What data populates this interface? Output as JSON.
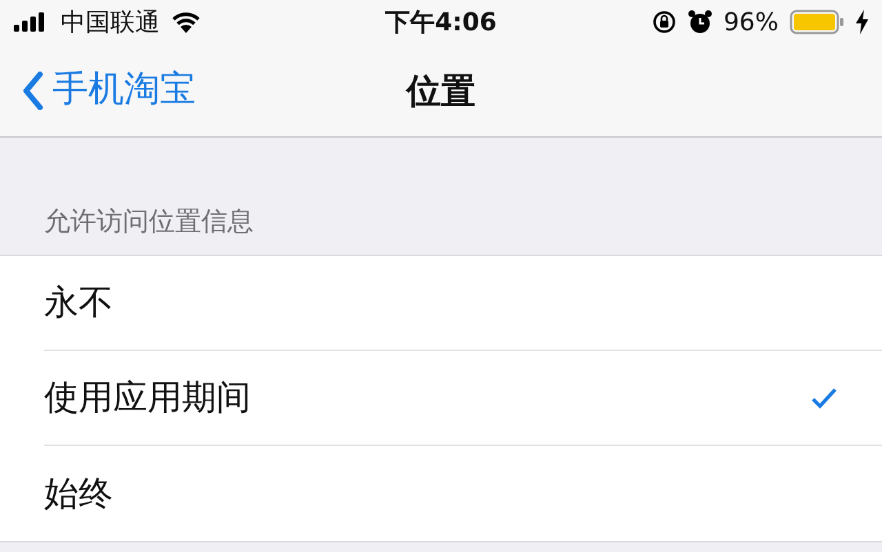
{
  "status_bar": {
    "carrier": "中国联通",
    "time": "下午4:06",
    "battery": "96%"
  },
  "nav_bar": {
    "back": "手机淘宝",
    "title": "位置"
  },
  "section": {
    "header": "允许访问位置信息",
    "options": [
      {
        "label": "永不",
        "selected": false
      },
      {
        "label": "使用应用期间",
        "selected": true
      },
      {
        "label": "始终",
        "selected": false
      }
    ]
  }
}
